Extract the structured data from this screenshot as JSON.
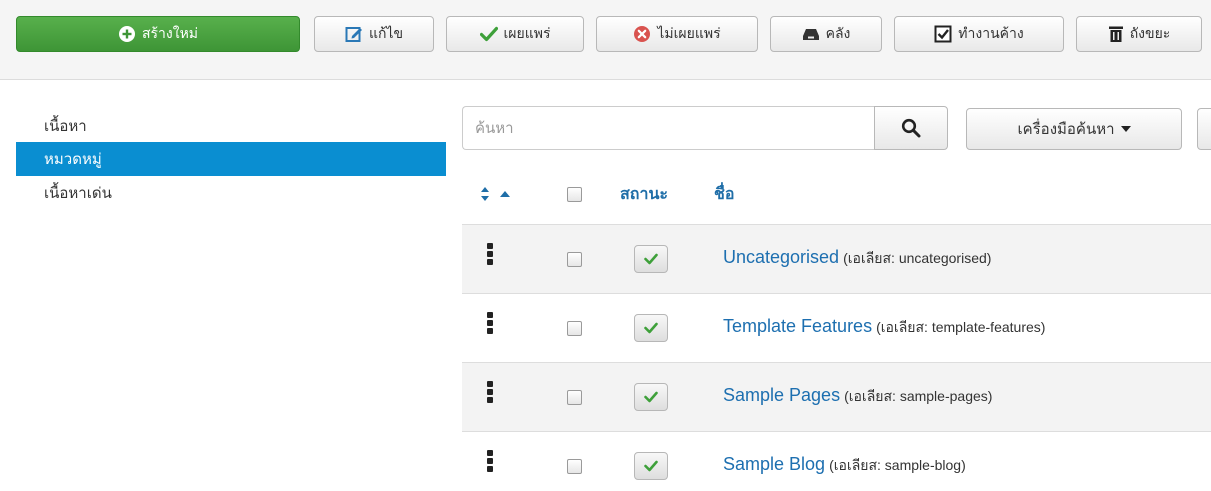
{
  "toolbar": {
    "new_label": "สร้างใหม่",
    "edit_label": "แก้ไข",
    "publish_label": "เผยแพร่",
    "unpublish_label": "ไม่เผยแพร่",
    "archive_label": "คลัง",
    "checkin_label": "ทำงานค้าง",
    "trash_label": "ถังขยะ"
  },
  "sidebar": {
    "items": [
      {
        "label": "เนื้อหา"
      },
      {
        "label": "หมวดหมู่"
      },
      {
        "label": "เนื้อหาเด่น"
      }
    ]
  },
  "search": {
    "placeholder": "ค้นหา",
    "tools_label": "เครื่องมือค้นหา"
  },
  "table": {
    "headers": {
      "status": "สถานะ",
      "title": "ชื่อ"
    },
    "rows": [
      {
        "title": "Uncategorised",
        "alias": "(เอเลียส: uncategorised)"
      },
      {
        "title": "Template Features",
        "alias": "(เอเลียส: template-features)"
      },
      {
        "title": "Sample Pages",
        "alias": "(เอเลียส: sample-pages)"
      },
      {
        "title": "Sample Blog",
        "alias": "(เอเลียส: sample-blog)"
      }
    ]
  },
  "colors": {
    "primary_green": "#4aa33f",
    "sidebar_active": "#0a8ed1",
    "link_blue": "#1d6fb0",
    "check_green": "#3ea03a",
    "unpublish_red": "#d9534f"
  },
  "icons": {
    "new": "plus-circle-icon",
    "edit": "edit-icon",
    "publish": "check-icon",
    "unpublish": "x-circle-icon",
    "archive": "archive-icon",
    "checkin": "checkbox-icon",
    "trash": "trash-icon",
    "search": "search-icon",
    "sort": "sort-icon",
    "drag": "drag-handle-icon"
  }
}
